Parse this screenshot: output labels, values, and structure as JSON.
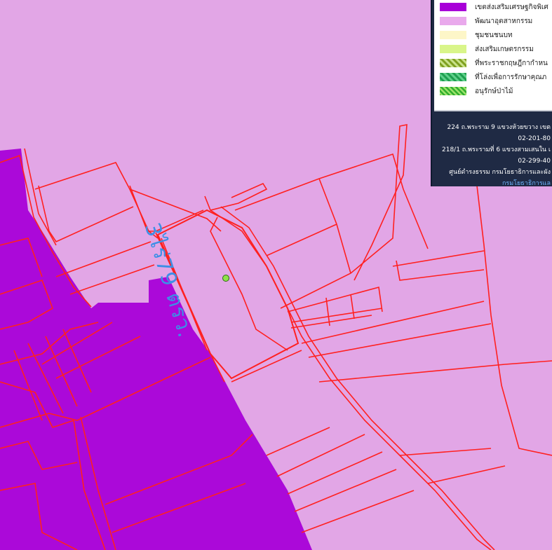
{
  "legend": {
    "items": [
      {
        "label": "เขตส่งเสริมเศรษฐกิจพิเศ",
        "color": "#a800d8",
        "pattern": "solid"
      },
      {
        "label": "พัฒนาอุตสาหกรรม",
        "color": "#e9a9ec",
        "pattern": "solid"
      },
      {
        "label": "ชุมชนชนบท",
        "color": "#fdf6c8",
        "pattern": "solid"
      },
      {
        "label": "ส่งเสริมเกษตรกรรม",
        "color": "#d9f58a",
        "pattern": "solid"
      },
      {
        "label": "ที่พระราชกฤษฎีกากำหน",
        "color": "#9bbf3a",
        "pattern": "hatch"
      },
      {
        "label": "ที่โล่งเพื่อการรักษาคุณภ",
        "color": "#2fbf6a",
        "pattern": "hatch"
      },
      {
        "label": "อนุรักษ์ป่าไม้",
        "color": "#2fbf3a",
        "pattern": "hatch-dense"
      }
    ]
  },
  "contacts": {
    "line1": "224 ถ.พระราม 9 แขวงห้วยขวาง เขต",
    "line2": "02-201-80",
    "line3": "218/1 ถ.พระรามที่ 6 แขวงสามเสนใน เ",
    "line4": "02-299-40",
    "line5": "ศูนย์ดำรงธรรม กรมโยธาธิการและผัง",
    "link": "กรมโยธาธิการแล"
  },
  "map": {
    "parcel_label": "3ไร่79 ตรว.",
    "colors": {
      "industrial": "#e2a6e6",
      "special_zone": "#a800d8",
      "boundary": "#ff1f1f"
    }
  }
}
